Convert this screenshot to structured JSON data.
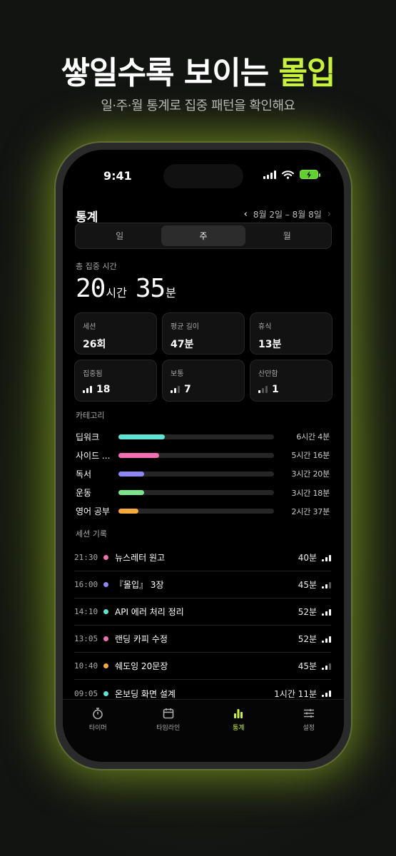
{
  "promo": {
    "headline_main": "쌓일수록 보이는 ",
    "headline_accent": "몰입",
    "subline": "일·주·월 통계로 집중 패턴을 확인해요"
  },
  "status_bar": {
    "time": "9:41"
  },
  "header": {
    "title": "통계",
    "date_range": "8월 2일 – 8월 8일"
  },
  "segment": {
    "options": [
      "일",
      "주",
      "월"
    ],
    "selected": "주"
  },
  "total": {
    "label": "총 집중 시간",
    "hours": "20",
    "hours_unit": "시간",
    "minutes": "35",
    "minutes_unit": "분"
  },
  "cards": [
    {
      "label": "세션",
      "value": "26회"
    },
    {
      "label": "평균 길이",
      "value": "47분"
    },
    {
      "label": "휴식",
      "value": "13분"
    },
    {
      "label": "집중됨",
      "value": "18",
      "level": 3
    },
    {
      "label": "보통",
      "value": "7",
      "level": 2
    },
    {
      "label": "산만함",
      "value": "1",
      "level": 1
    }
  ],
  "categories": {
    "label": "카테고리",
    "items": [
      {
        "name": "딥워크",
        "time": "6시간 4분",
        "fraction": 0.3,
        "color": "#5ee3d2"
      },
      {
        "name": "사이드 ...",
        "time": "5시간 16분",
        "fraction": 0.26,
        "color": "#f26fb4"
      },
      {
        "name": "독서",
        "time": "3시간 20분",
        "fraction": 0.165,
        "color": "#8f86f0"
      },
      {
        "name": "운동",
        "time": "3시간 18분",
        "fraction": 0.163,
        "color": "#7be38b"
      },
      {
        "name": "영어 공부",
        "time": "2시간 37분",
        "fraction": 0.13,
        "color": "#f7a93b"
      }
    ]
  },
  "sessions": {
    "label": "세션 기록",
    "items": [
      {
        "time": "21:30",
        "title": "뉴스레터 원고",
        "duration": "40분",
        "color": "#f26fb4",
        "level": 3
      },
      {
        "time": "16:00",
        "title": "『몰입』 3장",
        "duration": "45분",
        "color": "#8f86f0",
        "level": 2
      },
      {
        "time": "14:10",
        "title": "API 에러 처리 정리",
        "duration": "52분",
        "color": "#5ee3d2",
        "level": 3
      },
      {
        "time": "13:05",
        "title": "랜딩 카피 수정",
        "duration": "52분",
        "color": "#f26fb4",
        "level": 3
      },
      {
        "time": "10:40",
        "title": "쉐도잉 20문장",
        "duration": "45분",
        "color": "#f7a93b",
        "level": 2
      },
      {
        "time": "09:05",
        "title": "온보딩 화면 설계",
        "duration": "1시간 11분",
        "color": "#5ee3d2",
        "level": 3
      }
    ]
  },
  "tabbar": {
    "items": [
      {
        "label": "타이머",
        "icon": "stopwatch-icon"
      },
      {
        "label": "타임라인",
        "icon": "calendar-icon"
      },
      {
        "label": "통계",
        "icon": "bar-chart-icon"
      },
      {
        "label": "설정",
        "icon": "sliders-icon"
      }
    ],
    "active": "통계"
  },
  "colors": {
    "accent": "#c9f23a",
    "bar_active": "#ffffff",
    "bar_inactive": "#555555"
  }
}
